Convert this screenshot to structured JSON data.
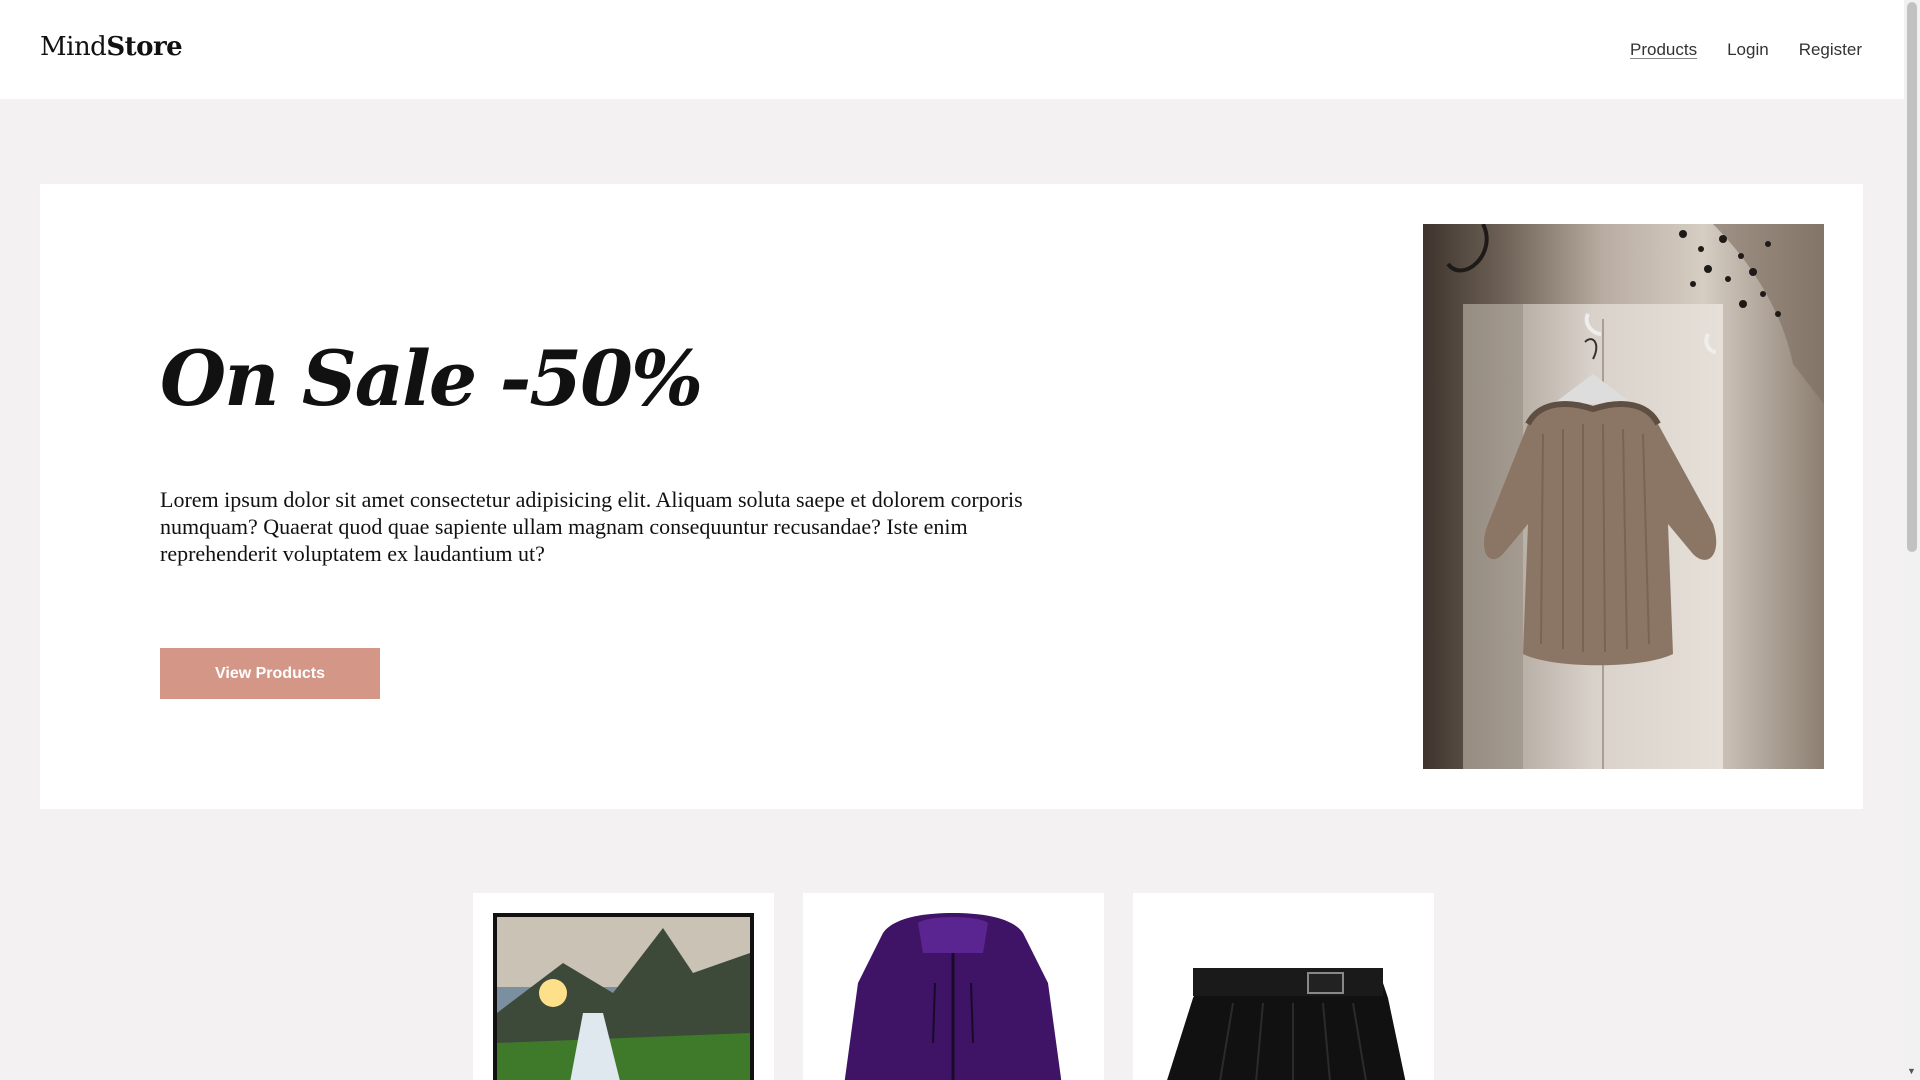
{
  "header": {
    "logo_light": "Mind",
    "logo_bold": "Store",
    "nav": [
      {
        "label": "Products",
        "active": true
      },
      {
        "label": "Login",
        "active": false
      },
      {
        "label": "Register",
        "active": false
      }
    ]
  },
  "hero": {
    "title": "On Sale -50%",
    "text": "Lorem ipsum dolor sit amet consectetur adipisicing elit. Aliquam soluta saepe et dolorem corporis numquam? Quaerat quod quae sapiente ullam magnam consequuntur recusandae? Iste enim reprehenderit voluptatem ex laudantium ut?",
    "button_label": "View Products",
    "image_icon": "sweater-on-wardrobe-image"
  },
  "products": {
    "cards": [
      {
        "image_icon": "monitor-landscape-image"
      },
      {
        "image_icon": "purple-jacket-image"
      },
      {
        "image_icon": "black-skirt-image"
      }
    ]
  },
  "colors": {
    "accent": "#d49686",
    "background": "#f3f1f1",
    "surface": "#ffffff"
  }
}
